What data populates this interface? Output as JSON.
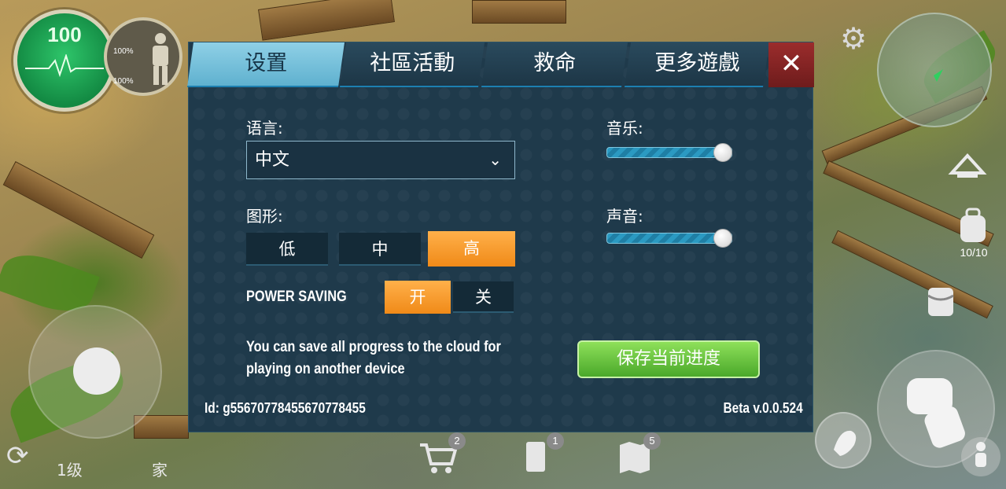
{
  "hud": {
    "health": "100",
    "food": "100%",
    "water": "100%",
    "backpack_count": "10/10",
    "level": "1级",
    "home": "家",
    "shop_badge": "2",
    "journal_badge": "1",
    "crafting_badge": "5"
  },
  "dialog": {
    "tabs": [
      "设置",
      "社區活動",
      "救命",
      "更多遊戲"
    ],
    "active_tab": "设置",
    "close_icon": "close-icon",
    "language": {
      "label": "语言:",
      "value": "中文"
    },
    "graphics": {
      "label": "图形:",
      "options": [
        "低",
        "中",
        "高"
      ],
      "selected": "高"
    },
    "power_saving": {
      "label": "POWER SAVING",
      "on": "开",
      "off": "关",
      "selected": "开"
    },
    "music": {
      "label": "音乐:",
      "level": 0.93
    },
    "sound": {
      "label": "声音:",
      "level": 0.93
    },
    "cloud_text": "You can save all progress to the cloud for playing on another device",
    "save_button": "保存当前进度",
    "id": "Id: g5567077845567077845​5",
    "version": "Beta v.0.0.524"
  },
  "colors": {
    "active_tab": "#6fbfd9",
    "selected_option": "#f39a2a",
    "save_button": "#5fbf36",
    "close_button": "#8a2424",
    "panel": "#1f3a4b"
  }
}
